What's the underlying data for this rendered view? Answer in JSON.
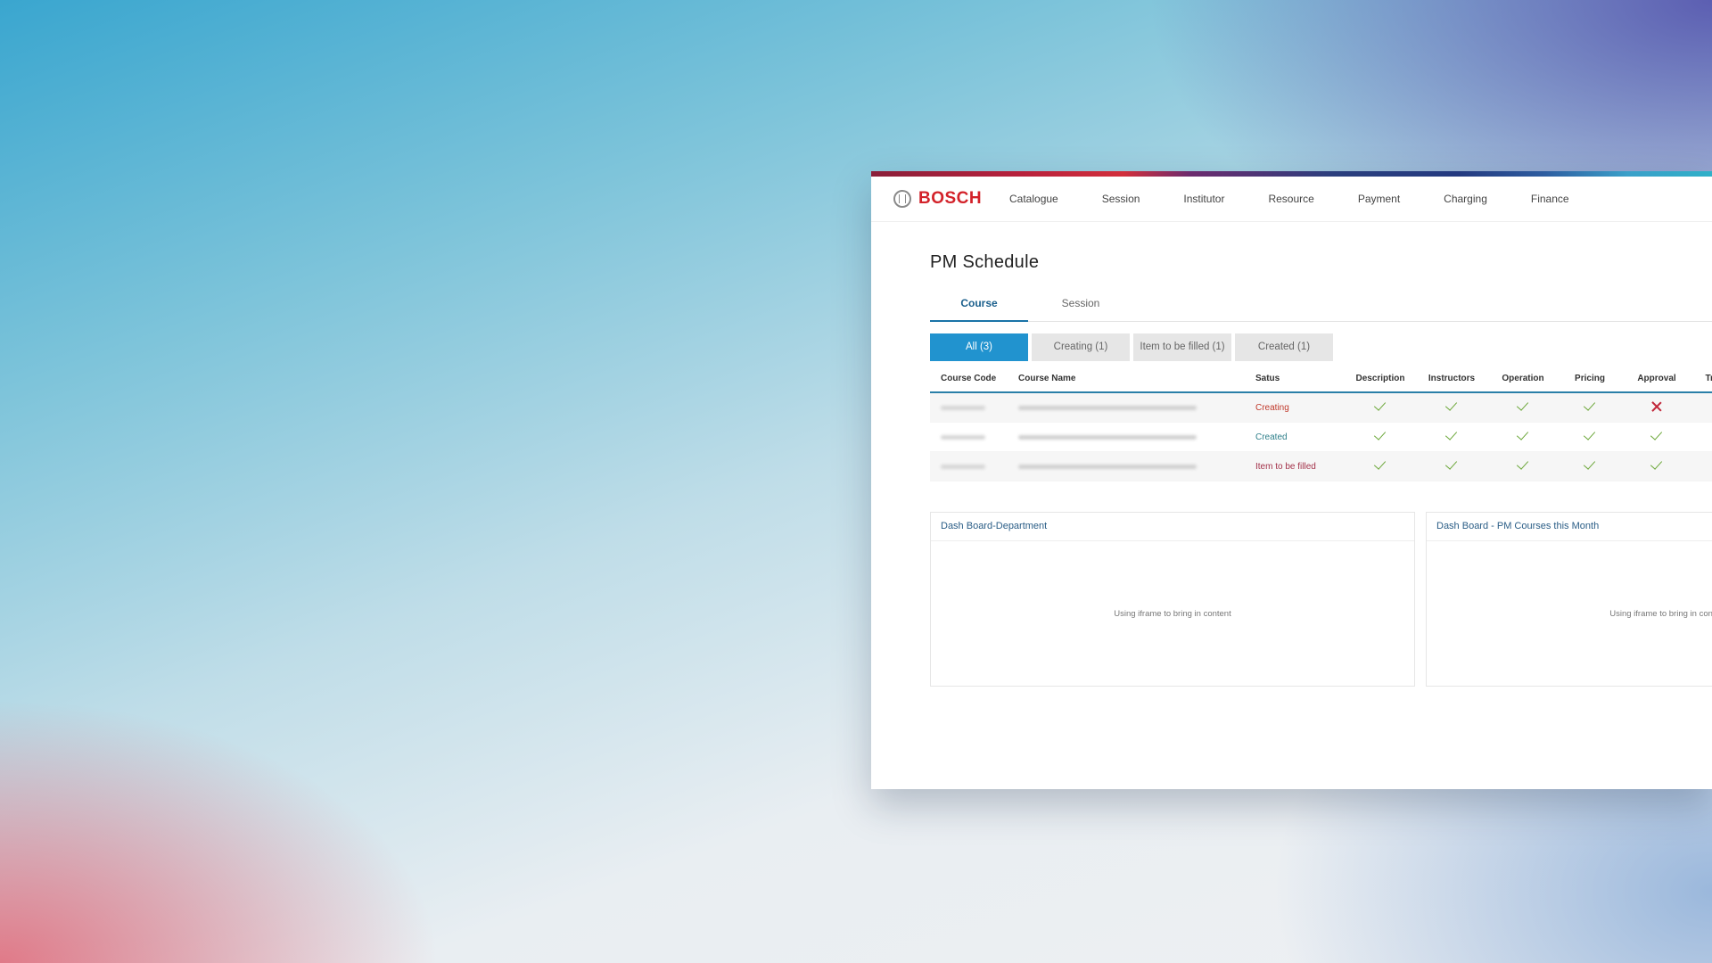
{
  "brand": {
    "name": "BOSCH"
  },
  "nav": [
    "Catalogue",
    "Session",
    "Institutor",
    "Resource",
    "Payment",
    "Charging",
    "Finance"
  ],
  "page": {
    "title": "PM Schedule"
  },
  "tabs": [
    {
      "label": "Course",
      "active": true
    },
    {
      "label": "Session",
      "active": false
    }
  ],
  "filters": [
    {
      "label": "All (3)",
      "active": true
    },
    {
      "label": "Creating (1)",
      "active": false
    },
    {
      "label": "Item to be filled (1)",
      "active": false
    },
    {
      "label": "Created (1)",
      "active": false
    }
  ],
  "table": {
    "headers": [
      "Course Code",
      "Course Name",
      "Satus",
      "Description",
      "Instructors",
      "Operation",
      "Pricing",
      "Approval",
      "TrainM It"
    ],
    "rows": [
      {
        "status": "Creating",
        "checks": [
          "ok",
          "ok",
          "ok",
          "ok",
          "no",
          "no"
        ]
      },
      {
        "status": "Created",
        "checks": [
          "ok",
          "ok",
          "ok",
          "ok",
          "ok",
          "ok"
        ]
      },
      {
        "status": "Item to be filled",
        "checks": [
          "ok",
          "ok",
          "ok",
          "ok",
          "ok",
          "no"
        ]
      }
    ]
  },
  "dashboards": [
    {
      "title": "Dash Board-Department",
      "body": "Using iframe to bring in content"
    },
    {
      "title": "Dash Board - PM Courses this Month",
      "body": "Using iframe to bring in content"
    }
  ],
  "colors": {
    "brand_red": "#d3222a",
    "accent_blue": "#2193cf",
    "check_green": "#6aa637",
    "cross_red": "#c1273a"
  },
  "icons": {
    "check": "check-icon",
    "cross": "cross-icon",
    "logo": "bosch-logo-icon"
  }
}
